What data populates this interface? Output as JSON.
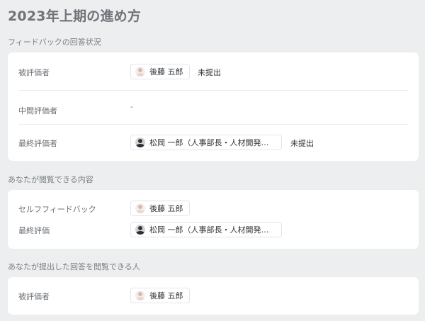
{
  "page": {
    "title": "2023年上期の進め方"
  },
  "feedback_status": {
    "heading": "フィードバックの回答状況",
    "rows": [
      {
        "label": "被評価者",
        "person": "後藤 五郎",
        "status": "未提出"
      },
      {
        "label": "中間評価者",
        "value": "-"
      },
      {
        "label": "最終評価者",
        "person": "松岡 一郎（人事部長・人材開発…",
        "status": "未提出"
      }
    ]
  },
  "viewable_content": {
    "heading": "あなたが閲覧できる内容",
    "rows": [
      {
        "label": "セルフフィードバック",
        "person": "後藤 五郎"
      },
      {
        "label": "最終評価",
        "person": "松岡 一郎（人事部長・人材開発…"
      }
    ]
  },
  "viewers": {
    "heading": "あなたが提出した回答を閲覧できる人",
    "rows": [
      {
        "label": "被評価者",
        "person": "後藤 五郎"
      }
    ]
  }
}
